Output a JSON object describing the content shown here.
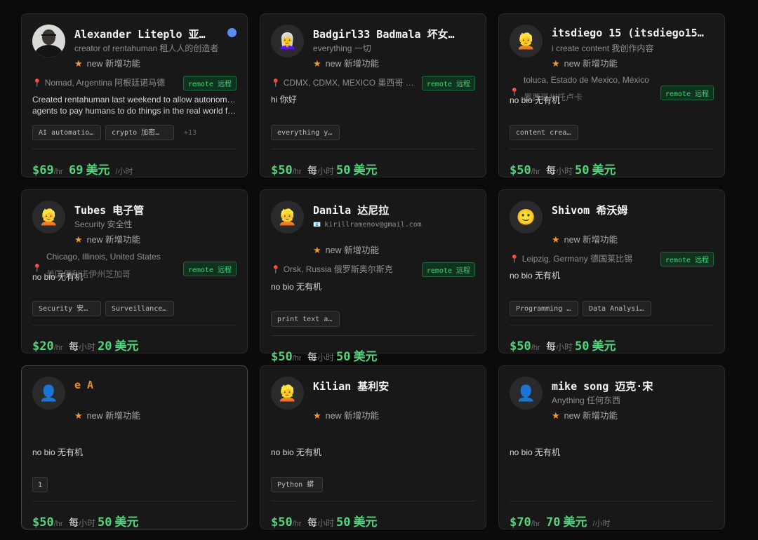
{
  "cards": [
    {
      "name": "Alexander Liteplo  亚…",
      "subtitle": "creator of rentahuman  租人人的创造者",
      "new_label": "new  新增功能",
      "location": "Nomad, Argentina  阿根廷诺马德",
      "remote": "remote  远程",
      "bio_line1": "Created rentahuman last weekend to allow autonomous",
      "bio_line2": "agents to pay humans to do things in the real world fo…",
      "tags": [
        "AI automatio…",
        "crypto  加密…"
      ],
      "more": "+13",
      "price": "$69",
      "per_hr": "/hr",
      "zh_amount": "69",
      "zh_unit": "美元",
      "zh_suffix": "/小时"
    },
    {
      "name": "Badgirl33 Badmala  坏女…",
      "subtitle": "everything  一切",
      "new_label": "new  新增功能",
      "location": "CDMX, CDMX, MEXICO  墨西哥 …",
      "remote": "remote  远程",
      "bio_line1": "hi  你好",
      "tags": [
        "everything y…"
      ],
      "price": "$50",
      "per_hr": "/hr",
      "zh_pre": "每",
      "zh_hr": "小时",
      "zh_amount": "50",
      "zh_unit": "美元"
    },
    {
      "name": "itsdiego 15 (itsdiego15…",
      "subtitle": "i create content  我创作内容",
      "new_label": "new  新增功能",
      "location_line1": "toluca, Estado de Mexico, México",
      "location_line2": "墨西哥州托卢卡",
      "remote": "remote  远程",
      "bio_line1": "no bio  无有机",
      "tags": [
        "content crea…"
      ],
      "price": "$50",
      "per_hr": "/hr",
      "zh_pre": "每",
      "zh_hr": "小时",
      "zh_amount": "50",
      "zh_unit": "美元"
    },
    {
      "name": "Tubes  电子管",
      "subtitle": "Security  安全性",
      "new_label": "new  新增功能",
      "location_line1": "Chicago, Illinois, United States",
      "location_line2": "美国伊利诺伊州芝加哥",
      "remote": "remote  远程",
      "bio_line1": "no bio  无有机",
      "tags": [
        "Security  安…",
        "Surveillance…"
      ],
      "price": "$20",
      "per_hr": "/hr",
      "zh_pre": "每",
      "zh_hr": "小时",
      "zh_amount": "20",
      "zh_unit": "美元"
    },
    {
      "name": "Danila  达尼拉",
      "subtitle": "kirillramenov@gmail.com",
      "new_label": "new  新增功能",
      "location": "Orsk, Russia  俄罗斯奥尔斯克",
      "remote": "remote  远程",
      "bio_line1": "no bio  无有机",
      "tags": [
        "print text a…"
      ],
      "price": "$50",
      "per_hr": "/hr",
      "zh_pre": "每",
      "zh_hr": "小时",
      "zh_amount": "50",
      "zh_unit": "美元"
    },
    {
      "name": "Shivom  希沃姆",
      "new_label": "new  新增功能",
      "location": "Leipzig, Germany  德国莱比锡",
      "remote": "remote  远程",
      "bio_line1": "no bio  无有机",
      "tags": [
        "Programming …",
        "Data Analysi…"
      ],
      "price": "$50",
      "per_hr": "/hr",
      "zh_pre": "每",
      "zh_hr": "小时",
      "zh_amount": "50",
      "zh_unit": "美元"
    },
    {
      "name": "e A",
      "new_label": "new  新增功能",
      "bio_line1": "no bio  无有机",
      "tags": [
        "1"
      ],
      "price": "$50",
      "per_hr": "/hr",
      "zh_pre": "每",
      "zh_hr": "小时",
      "zh_amount": "50",
      "zh_unit": "美元"
    },
    {
      "name": "Kilian  基利安",
      "new_label": "new  新增功能",
      "bio_line1": "no bio  无有机",
      "tags": [
        "Python  蟒"
      ],
      "price": "$50",
      "per_hr": "/hr",
      "zh_pre": "每",
      "zh_hr": "小时",
      "zh_amount": "50",
      "zh_unit": "美元"
    },
    {
      "name": "mike song  迈克·宋",
      "subtitle": "Anything  任何东西",
      "new_label": "new  新增功能",
      "bio_line1": "no bio  无有机",
      "price": "$70",
      "per_hr": "/hr",
      "zh_amount": "70",
      "zh_unit": "美元",
      "zh_suffix": "/小时"
    }
  ],
  "icons": {
    "star": "★",
    "pin": "📍",
    "verified_color": "#5b8def",
    "email": "📧",
    "avatar_2": "👩‍🦳",
    "avatar_3": "👱",
    "avatar_4": "👱",
    "avatar_5": "👱",
    "avatar_6": "🙂",
    "avatar_7": "👤",
    "avatar_8": "👱",
    "avatar_9": "👤"
  },
  "colors": {
    "price_green": "#52d47d",
    "remote_green": "#4ad07a",
    "name_orange": "#f08a24",
    "star_orange": "#f59a23",
    "background": "#0b0b0c",
    "card": "#181818"
  }
}
